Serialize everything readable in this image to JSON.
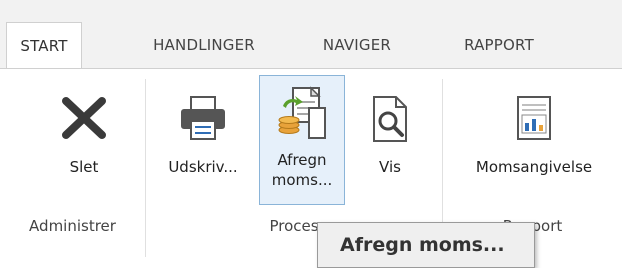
{
  "tabs": [
    {
      "label": "START",
      "active": true
    },
    {
      "label": "HANDLINGER",
      "active": false
    },
    {
      "label": "NAVIGER",
      "active": false
    },
    {
      "label": "RAPPORT",
      "active": false
    }
  ],
  "groups": {
    "administrer": {
      "label": "Administrer"
    },
    "proces": {
      "label": "Proces"
    },
    "rapport": {
      "label": "Rapport"
    }
  },
  "buttons": {
    "slet": {
      "label": "Slet",
      "icon": "delete-x-icon"
    },
    "udskriv": {
      "label": "Udskriv...",
      "icon": "printer-icon"
    },
    "afregn": {
      "label_line1": "Afregn",
      "label_line2": "moms...",
      "icon": "settle-vat-icon"
    },
    "vis": {
      "label": "Vis",
      "icon": "preview-magnifier-icon"
    },
    "momsangivelse": {
      "label": "Momsangivelse",
      "icon": "vat-report-chart-icon"
    }
  },
  "tooltip": {
    "text": "Afregn moms..."
  },
  "colors": {
    "tab_bar": "#f2f2f2",
    "ribbon": "#ffffff",
    "hover_fill": "#e6f0fa",
    "hover_border": "#8ab4d8",
    "accent_green": "#5aa02c",
    "accent_blue": "#2f6db5",
    "accent_orange": "#e8a23a"
  }
}
